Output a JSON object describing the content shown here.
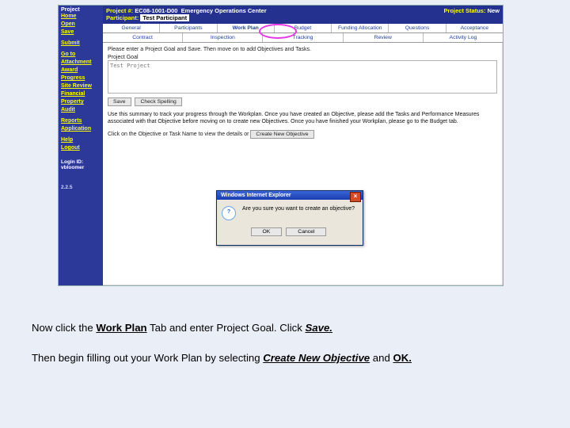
{
  "sidebar": {
    "title": "Project",
    "items": [
      "Home",
      "Open",
      "Save"
    ],
    "items2": [
      "Submit"
    ],
    "items3": [
      "Go to",
      "Attachment",
      "Award",
      "Progress",
      "Site Review",
      "Financial",
      "Property",
      "Audit"
    ],
    "items4": [
      "Reports",
      "Application"
    ],
    "items5": [
      "Help",
      "Logout"
    ],
    "login_label": "Login ID:",
    "login_user": "vbloomer",
    "version": "2.2.5"
  },
  "header": {
    "proj_lbl": "Project #:",
    "proj_val": "EC08-1001-D00",
    "proj_name": "Emergency Operations Center",
    "status_lbl": "Project Status:",
    "status_val": "New",
    "part_lbl": "Participant:",
    "part_val": "Test Participant"
  },
  "tabs_row1": [
    "General",
    "Participants",
    "Work Plan",
    "Budget",
    "Funding Allocation",
    "Questions",
    "Acceptance"
  ],
  "tabs_row2": [
    "Contract",
    "Inspection",
    "Tracking",
    "Review",
    "Activity Log"
  ],
  "body": {
    "hint": "Please enter a Project Goal and Save. Then move on to add Objectives and Tasks.",
    "goal_lbl": "Project Goal",
    "goal_val": "Test Project",
    "save": "Save",
    "spell": "Check Spelling",
    "summary": "Use this summary to track your progress through the Workplan. Once you have created an Objective, please add the Tasks and Performance Measures associated with that Objective before moving on to create new Objectives. Once you have finished your Workplan, please go to the Budget tab.",
    "click_line": "Click on the Objective or Task Name to view the details or",
    "new_obj": "Create New Objective"
  },
  "dialog": {
    "title": "Windows Internet Explorer",
    "msg": "Are you sure you want to create an objective?",
    "ok": "OK",
    "cancel": "Cancel"
  },
  "caption": {
    "line1_a": "Now click the ",
    "line1_b": "Work Plan",
    "line1_c": " Tab and enter Project Goal.  Click ",
    "line1_d": "Save.",
    "line2_a": "Then begin filling out your Work Plan by selecting ",
    "line2_b": "Create New Objective",
    "line2_c": " and ",
    "line2_d": "OK."
  }
}
